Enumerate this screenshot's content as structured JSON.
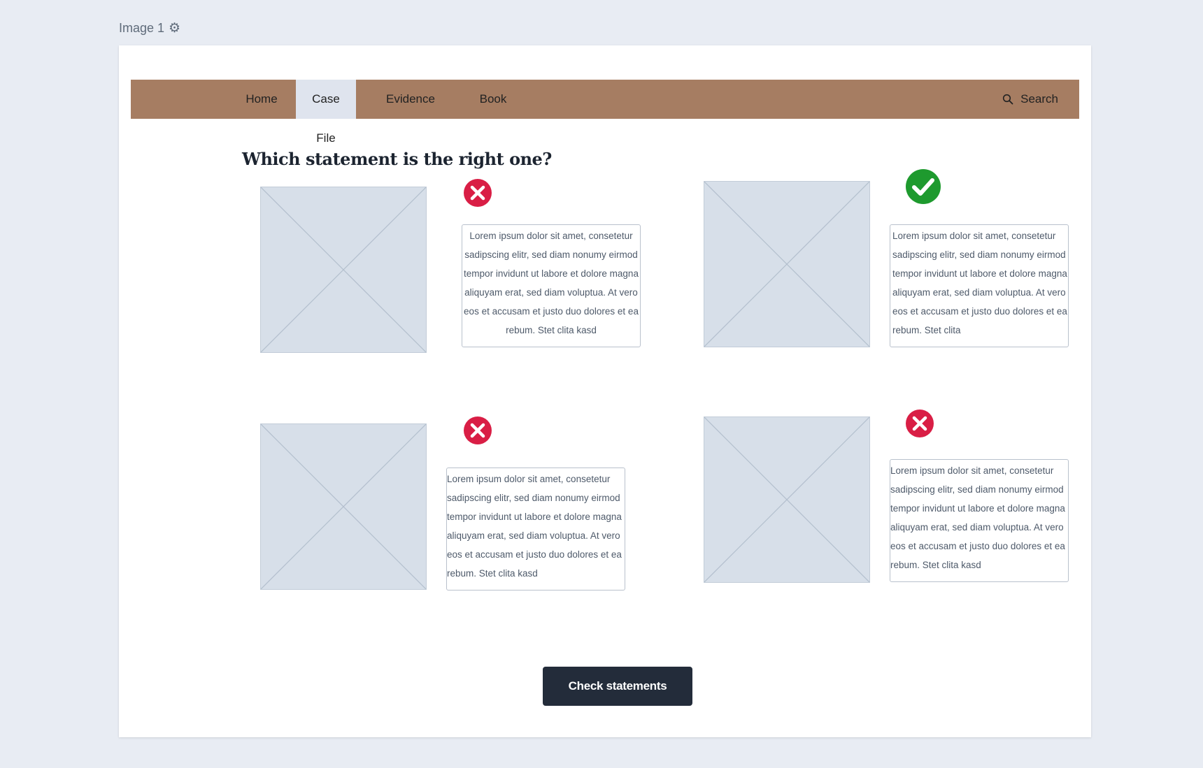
{
  "frame": {
    "label": "Image 1",
    "settings_icon": "gear-icon"
  },
  "nav": {
    "items": [
      {
        "label": "Home",
        "active": false
      },
      {
        "label": "Case File",
        "active": true
      },
      {
        "label": "Evidence",
        "active": false
      },
      {
        "label": "Book",
        "active": false
      }
    ],
    "search_label": "Search",
    "search_icon": "search-icon",
    "bar_color": "#a67d62",
    "active_color": "#dfe4ee"
  },
  "question": "Which statement is the right one?",
  "statements": [
    {
      "status": "incorrect",
      "status_icon": "x-circle-icon",
      "text": "Lorem ipsum dolor sit amet, consetetur sadipscing elitr, sed diam nonumy eirmod tempor invidunt ut labore et dolore magna aliquyam erat, sed diam voluptua. At vero eos et accusam et justo duo dolores et ea rebum. Stet clita kasd"
    },
    {
      "status": "correct",
      "status_icon": "check-circle-icon",
      "text": "Lorem ipsum dolor sit amet, consetetur sadipscing elitr, sed diam nonumy eirmod tempor invidunt ut labore et dolore magna aliquyam erat, sed diam voluptua. At vero eos et accusam et justo duo dolores et ea rebum. Stet clita"
    },
    {
      "status": "incorrect",
      "status_icon": "x-circle-icon",
      "text": "Lorem ipsum dolor sit amet, consetetur sadipscing elitr, sed diam nonumy eirmod tempor invidunt ut labore et dolore magna aliquyam erat, sed diam voluptua. At vero eos et accusam et justo duo dolores et ea rebum. Stet clita kasd"
    },
    {
      "status": "incorrect",
      "status_icon": "x-circle-icon",
      "text": "Lorem ipsum dolor sit amet, consetetur sadipscing elitr, sed diam nonumy eirmod tempor invidunt ut labore et dolore magna aliquyam erat, sed diam voluptua. At vero eos et accusam et justo duo dolores et ea rebum. Stet clita kasd"
    }
  ],
  "colors": {
    "incorrect": "#d91e45",
    "correct": "#1e9a2e",
    "button": "#232c3a"
  },
  "check_button": "Check statements"
}
